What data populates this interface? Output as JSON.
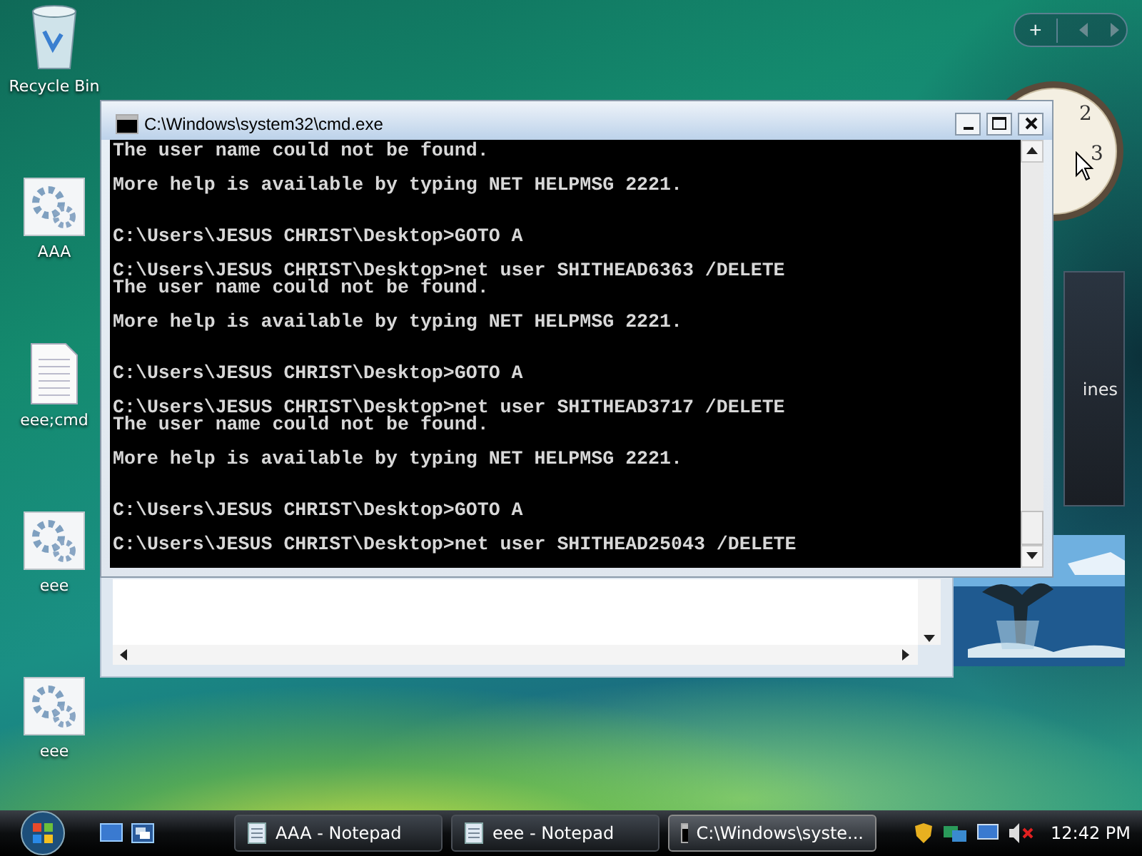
{
  "desktop_icons": [
    {
      "label": "Recycle Bin",
      "kind": "bin"
    },
    {
      "label": "AAA",
      "kind": "script"
    },
    {
      "label": "eee;cmd",
      "kind": "text"
    },
    {
      "label": "eee",
      "kind": "script"
    },
    {
      "label": "eee",
      "kind": "script"
    }
  ],
  "gadgets": {
    "sidebar_add": "+",
    "clock_numerals": [
      "2",
      "3"
    ],
    "feed_text": "ines"
  },
  "console": {
    "title": "C:\\Windows\\system32\\cmd.exe",
    "lines": [
      {
        "kind": "text",
        "text": "The user name could not be found."
      },
      {
        "kind": "blank"
      },
      {
        "kind": "text",
        "text": "More help is available by typing NET HELPMSG 2221."
      },
      {
        "kind": "blank"
      },
      {
        "kind": "blank"
      },
      {
        "kind": "text",
        "text": "C:\\Users\\JESUS CHRIST\\Desktop>GOTO A"
      },
      {
        "kind": "blank"
      },
      {
        "kind": "text",
        "text": "C:\\Users\\JESUS CHRIST\\Desktop>net user SHITHEAD6363 /DELETE"
      },
      {
        "kind": "text",
        "text": "The user name could not be found."
      },
      {
        "kind": "blank"
      },
      {
        "kind": "text",
        "text": "More help is available by typing NET HELPMSG 2221."
      },
      {
        "kind": "blank"
      },
      {
        "kind": "blank"
      },
      {
        "kind": "text",
        "text": "C:\\Users\\JESUS CHRIST\\Desktop>GOTO A"
      },
      {
        "kind": "blank"
      },
      {
        "kind": "text",
        "text": "C:\\Users\\JESUS CHRIST\\Desktop>net user SHITHEAD3717 /DELETE"
      },
      {
        "kind": "text",
        "text": "The user name could not be found."
      },
      {
        "kind": "blank"
      },
      {
        "kind": "text",
        "text": "More help is available by typing NET HELPMSG 2221."
      },
      {
        "kind": "blank"
      },
      {
        "kind": "blank"
      },
      {
        "kind": "text",
        "text": "C:\\Users\\JESUS CHRIST\\Desktop>GOTO A"
      },
      {
        "kind": "blank"
      },
      {
        "kind": "text",
        "text": "C:\\Users\\JESUS CHRIST\\Desktop>net user SHITHEAD25043 /DELETE"
      }
    ]
  },
  "taskbar": {
    "tasks": [
      {
        "label": "AAA - Notepad",
        "kind": "notepad",
        "selected": false
      },
      {
        "label": "eee - Notepad",
        "kind": "notepad",
        "selected": false
      },
      {
        "label": "C:\\Windows\\syste...",
        "kind": "console",
        "selected": true
      }
    ],
    "clock": "12:42 PM"
  }
}
